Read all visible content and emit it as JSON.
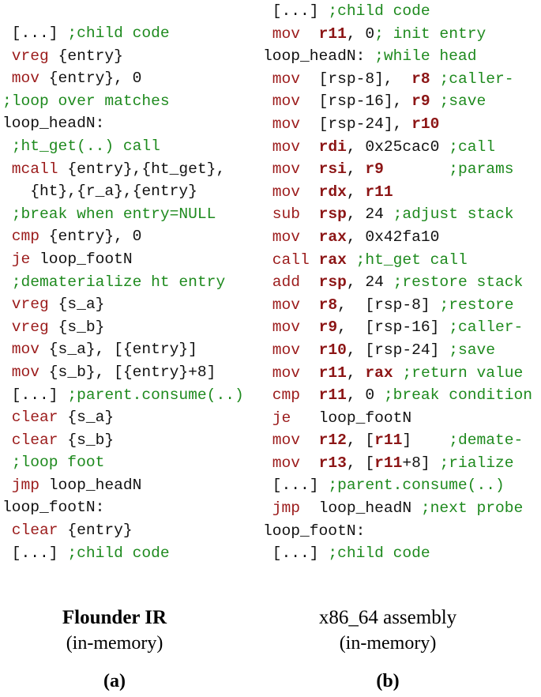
{
  "colors": {
    "mnemonic": "#9b1b1b",
    "register": "#8c1515",
    "text": "#111111",
    "comment": "#1e8a1e"
  },
  "panel_a": {
    "title": "Flounder IR",
    "subtitle": "(in-memory)",
    "label": "(a)",
    "lines": [
      [
        [
          "txt",
          " [...] "
        ],
        [
          "cmt",
          ";child code"
        ]
      ],
      [
        [
          "op",
          " vreg "
        ],
        [
          "txt",
          "{entry}"
        ]
      ],
      [
        [
          "op",
          " mov "
        ],
        [
          "txt",
          "{entry}, 0"
        ]
      ],
      [
        [
          "cmt",
          ";loop over matches"
        ]
      ],
      [
        [
          "txt",
          "loop_headN:"
        ]
      ],
      [
        [
          "cmt",
          " ;ht_get(..) call"
        ]
      ],
      [
        [
          "op",
          " mcall "
        ],
        [
          "txt",
          "{entry},{ht_get},"
        ]
      ],
      [
        [
          "txt",
          "   {ht},{r_a},{entry}"
        ]
      ],
      [
        [
          "cmt",
          " ;break when entry=NULL"
        ]
      ],
      [
        [
          "op",
          " cmp "
        ],
        [
          "txt",
          "{entry}, 0"
        ]
      ],
      [
        [
          "op",
          " je "
        ],
        [
          "txt",
          "loop_footN"
        ]
      ],
      [
        [
          "cmt",
          " ;dematerialize ht entry"
        ]
      ],
      [
        [
          "op",
          " vreg "
        ],
        [
          "txt",
          "{s_a}"
        ]
      ],
      [
        [
          "op",
          " vreg "
        ],
        [
          "txt",
          "{s_b}"
        ]
      ],
      [
        [
          "op",
          " mov "
        ],
        [
          "txt",
          "{s_a}, [{entry}]"
        ]
      ],
      [
        [
          "op",
          " mov "
        ],
        [
          "txt",
          "{s_b}, [{entry}+8]"
        ]
      ],
      [
        [
          "txt",
          " [...] "
        ],
        [
          "cmt",
          ";parent.consume(..)"
        ]
      ],
      [
        [
          "op",
          " clear "
        ],
        [
          "txt",
          "{s_a}"
        ]
      ],
      [
        [
          "op",
          " clear "
        ],
        [
          "txt",
          "{s_b}"
        ]
      ],
      [
        [
          "cmt",
          " ;loop foot"
        ]
      ],
      [
        [
          "op",
          " jmp "
        ],
        [
          "txt",
          "loop_headN"
        ]
      ],
      [
        [
          "txt",
          "loop_footN:"
        ]
      ],
      [
        [
          "op",
          " clear "
        ],
        [
          "txt",
          "{entry}"
        ]
      ],
      [
        [
          "txt",
          " [...] "
        ],
        [
          "cmt",
          ";child code"
        ]
      ]
    ]
  },
  "panel_b": {
    "title": "x86_64 assembly",
    "subtitle": "(in-memory)",
    "label": "(b)",
    "lines": [
      [
        [
          "txt",
          " [...] "
        ],
        [
          "cmt",
          ";child code"
        ]
      ],
      [
        [
          "op",
          " mov  "
        ],
        [
          "reg",
          "r11"
        ],
        [
          "txt",
          ", 0"
        ],
        [
          "cmt",
          "; init entry"
        ]
      ],
      [
        [
          "txt",
          "loop_headN: "
        ],
        [
          "cmt",
          ";while head"
        ]
      ],
      [
        [
          "op",
          " mov  "
        ],
        [
          "txt",
          "[rsp-8],  "
        ],
        [
          "reg",
          "r8"
        ],
        [
          "txt",
          " "
        ],
        [
          "cmt",
          ";caller-"
        ]
      ],
      [
        [
          "op",
          " mov  "
        ],
        [
          "txt",
          "[rsp-16], "
        ],
        [
          "reg",
          "r9"
        ],
        [
          "txt",
          " "
        ],
        [
          "cmt",
          ";save"
        ]
      ],
      [
        [
          "op",
          " mov  "
        ],
        [
          "txt",
          "[rsp-24], "
        ],
        [
          "reg",
          "r10"
        ]
      ],
      [
        [
          "op",
          " mov  "
        ],
        [
          "reg",
          "rdi"
        ],
        [
          "txt",
          ", 0x25cac0 "
        ],
        [
          "cmt",
          ";call"
        ]
      ],
      [
        [
          "op",
          " mov  "
        ],
        [
          "reg",
          "rsi"
        ],
        [
          "txt",
          ", "
        ],
        [
          "reg",
          "r9"
        ],
        [
          "txt",
          "       "
        ],
        [
          "cmt",
          ";params"
        ]
      ],
      [
        [
          "op",
          " mov  "
        ],
        [
          "reg",
          "rdx"
        ],
        [
          "txt",
          ", "
        ],
        [
          "reg",
          "r11"
        ]
      ],
      [
        [
          "op",
          " sub  "
        ],
        [
          "reg",
          "rsp"
        ],
        [
          "txt",
          ", 24 "
        ],
        [
          "cmt",
          ";adjust stack"
        ]
      ],
      [
        [
          "op",
          " mov  "
        ],
        [
          "reg",
          "rax"
        ],
        [
          "txt",
          ", 0x42fa10"
        ]
      ],
      [
        [
          "op",
          " call "
        ],
        [
          "reg",
          "rax"
        ],
        [
          "txt",
          " "
        ],
        [
          "cmt",
          ";ht_get call"
        ]
      ],
      [
        [
          "op",
          " add  "
        ],
        [
          "reg",
          "rsp"
        ],
        [
          "txt",
          ", 24 "
        ],
        [
          "cmt",
          ";restore stack"
        ]
      ],
      [
        [
          "op",
          " mov  "
        ],
        [
          "reg",
          "r8"
        ],
        [
          "txt",
          ",  [rsp-8] "
        ],
        [
          "cmt",
          ";restore"
        ]
      ],
      [
        [
          "op",
          " mov  "
        ],
        [
          "reg",
          "r9"
        ],
        [
          "txt",
          ",  [rsp-16] "
        ],
        [
          "cmt",
          ";caller-"
        ]
      ],
      [
        [
          "op",
          " mov  "
        ],
        [
          "reg",
          "r10"
        ],
        [
          "txt",
          ", [rsp-24] "
        ],
        [
          "cmt",
          ";save"
        ]
      ],
      [
        [
          "op",
          " mov  "
        ],
        [
          "reg",
          "r11"
        ],
        [
          "txt",
          ", "
        ],
        [
          "reg",
          "rax"
        ],
        [
          "txt",
          " "
        ],
        [
          "cmt",
          ";return value"
        ]
      ],
      [
        [
          "op",
          " cmp  "
        ],
        [
          "reg",
          "r11"
        ],
        [
          "txt",
          ", 0 "
        ],
        [
          "cmt",
          ";break condition"
        ]
      ],
      [
        [
          "op",
          " je   "
        ],
        [
          "txt",
          "loop_footN"
        ]
      ],
      [
        [
          "op",
          " mov  "
        ],
        [
          "reg",
          "r12"
        ],
        [
          "txt",
          ", ["
        ],
        [
          "reg",
          "r11"
        ],
        [
          "txt",
          "]    "
        ],
        [
          "cmt",
          ";demate-"
        ]
      ],
      [
        [
          "op",
          " mov  "
        ],
        [
          "reg",
          "r13"
        ],
        [
          "txt",
          ", ["
        ],
        [
          "reg",
          "r11"
        ],
        [
          "txt",
          "+8] "
        ],
        [
          "cmt",
          ";rialize"
        ]
      ],
      [
        [
          "txt",
          " [...] "
        ],
        [
          "cmt",
          ";parent.consume(..)"
        ]
      ],
      [
        [
          "op",
          " jmp  "
        ],
        [
          "txt",
          "loop_headN "
        ],
        [
          "cmt",
          ";next probe"
        ]
      ],
      [
        [
          "txt",
          "loop_footN:"
        ]
      ],
      [
        [
          "txt",
          " [...] "
        ],
        [
          "cmt",
          ";child code"
        ]
      ]
    ]
  }
}
